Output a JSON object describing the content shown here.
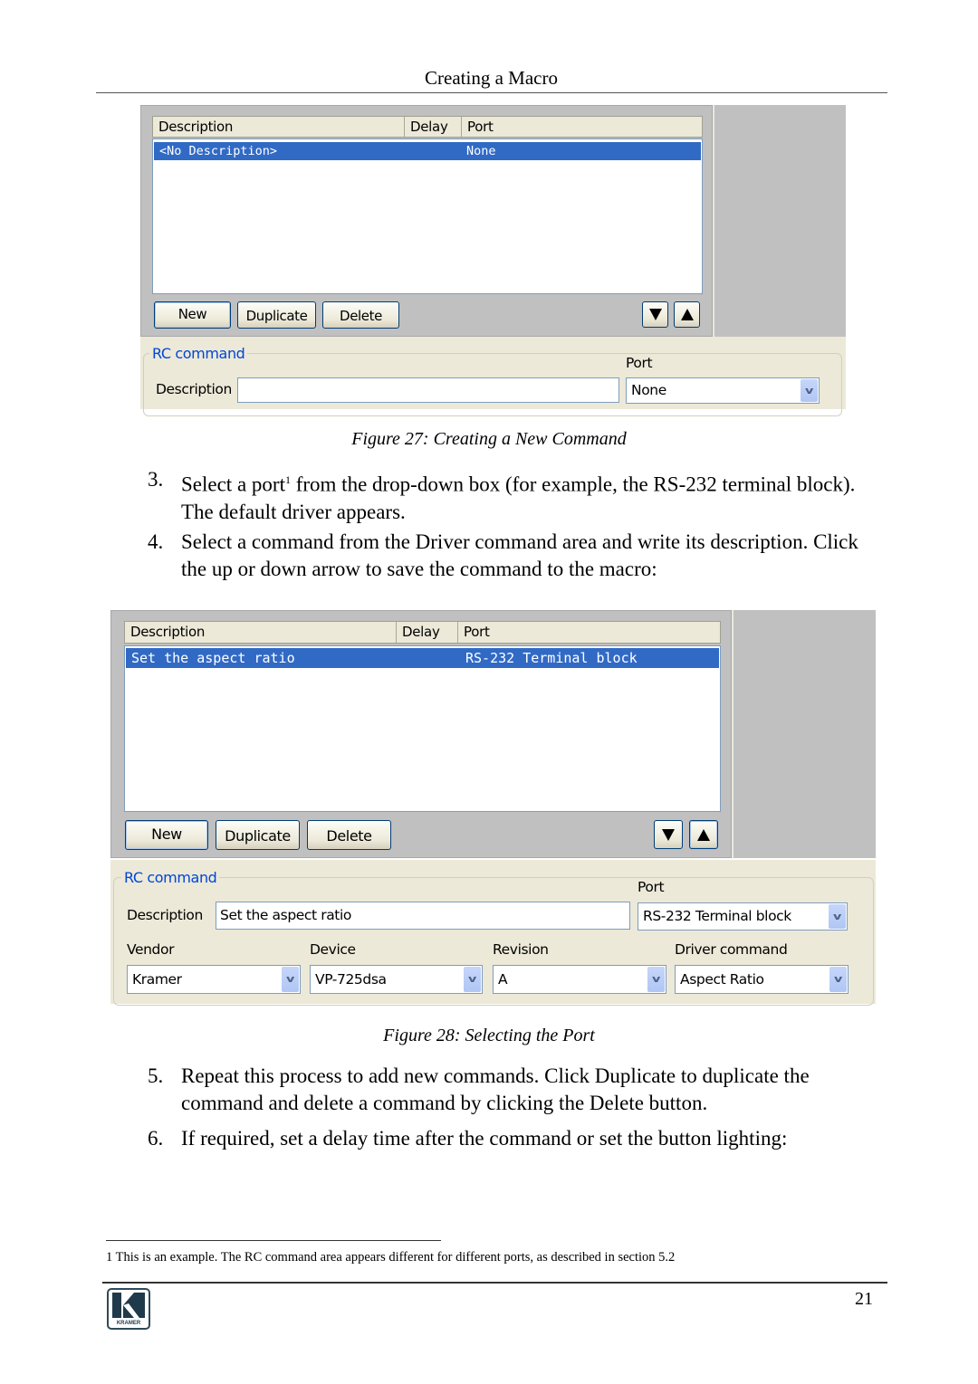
{
  "header": {
    "running_title": "Creating a Macro"
  },
  "figure27": {
    "caption": "Figure 27: Creating a New Command",
    "list_columns": [
      "Description",
      "Delay",
      "Port"
    ],
    "rows": [
      {
        "description": "<No Description>",
        "delay": "",
        "port": "None",
        "selected": true
      }
    ],
    "buttons": {
      "new": "New",
      "duplicate": "Duplicate",
      "delete": "Delete"
    },
    "move_down_icon": "triangle-down-icon",
    "move_up_icon": "triangle-up-icon",
    "rc_command": {
      "group_title": "RC command",
      "description_label": "Description",
      "description_value": "",
      "port_label": "Port",
      "port_value": "None"
    }
  },
  "steps_a": [
    {
      "num": "3.",
      "text_before": "Select a port",
      "footnote_ref": "1",
      "text_after": " from the drop-down box (for example, the RS-232 terminal block). The default driver appears."
    },
    {
      "num": "4.",
      "text": "Select a command from the Driver command area and write its description. Click the up or down arrow to save the command to the macro:"
    }
  ],
  "figure28": {
    "caption": "Figure 28: Selecting the Port",
    "list_columns": [
      "Description",
      "Delay",
      "Port"
    ],
    "rows": [
      {
        "description": "Set the aspect ratio",
        "delay": "",
        "port": "RS-232 Terminal block",
        "selected": true
      }
    ],
    "buttons": {
      "new": "New",
      "duplicate": "Duplicate",
      "delete": "Delete"
    },
    "rc_command": {
      "group_title": "RC command",
      "description_label": "Description",
      "description_value": "Set the aspect ratio",
      "port_label": "Port",
      "port_value": "RS-232 Terminal block",
      "vendor_label": "Vendor",
      "vendor_value": "Kramer",
      "device_label": "Device",
      "device_value": "VP-725dsa",
      "revision_label": "Revision",
      "revision_value": "A",
      "driver_command_label": "Driver command",
      "driver_command_value": "Aspect Ratio"
    }
  },
  "steps_b": [
    {
      "num": "5.",
      "text": "Repeat this process to add new commands. Click Duplicate to duplicate the command and delete a command by clicking the Delete button."
    },
    {
      "num": "6.",
      "text": "If required, set a delay time after the command or set the button lighting:"
    }
  ],
  "footer": {
    "footnote": "1 This is an example. The RC command area appears different for different ports, as described in section 5.2",
    "page_number": "21",
    "logo_text": "KRAMER",
    "logo_letter": "K"
  },
  "colors": {
    "selection": "#316ac5",
    "group_title": "#0046d5",
    "panel": "#ece9d8",
    "list_bg": "#c0c0c0"
  }
}
